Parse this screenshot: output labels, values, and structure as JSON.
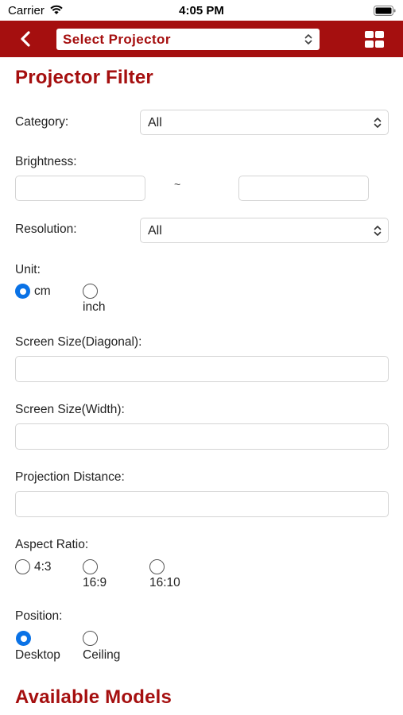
{
  "status_bar": {
    "carrier": "Carrier",
    "time": "4:05 PM"
  },
  "nav": {
    "select_label": "Select Projector"
  },
  "filter": {
    "title": "Projector Filter",
    "category": {
      "label": "Category:",
      "value": "All"
    },
    "brightness": {
      "label": "Brightness:",
      "separator": "~",
      "min_value": "",
      "max_value": ""
    },
    "resolution": {
      "label": "Resolution:",
      "value": "All"
    },
    "unit": {
      "label": "Unit:",
      "options": [
        "cm",
        "inch"
      ],
      "selected": "cm"
    },
    "screen_size_diagonal": {
      "label": "Screen Size(Diagonal):",
      "value": ""
    },
    "screen_size_width": {
      "label": "Screen Size(Width):",
      "value": ""
    },
    "projection_distance": {
      "label": "Projection Distance:",
      "value": ""
    },
    "aspect_ratio": {
      "label": "Aspect Ratio:",
      "options": [
        "4:3",
        "16:9",
        "16:10"
      ],
      "selected": ""
    },
    "position": {
      "label": "Position:",
      "options": [
        "Desktop",
        "Ceiling"
      ],
      "selected": "Desktop"
    }
  },
  "models": {
    "title": "Available Models"
  },
  "colors": {
    "brand": "#a50f0f",
    "radio_selected": "#0a72e6",
    "border": "#d4d4d4"
  }
}
